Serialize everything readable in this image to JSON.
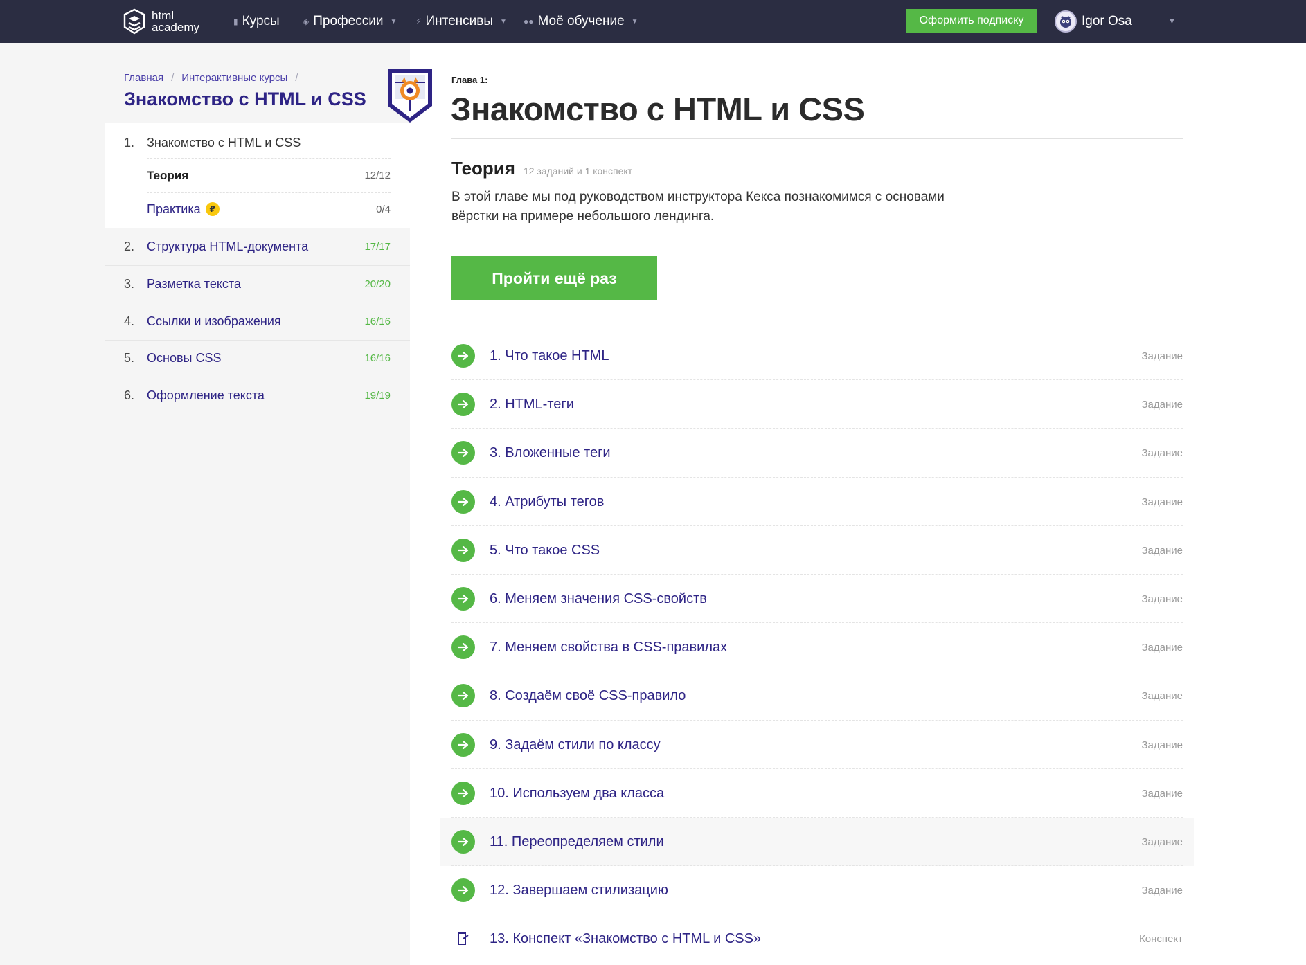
{
  "header": {
    "logo_line1": "html",
    "logo_line2": "academy",
    "nav": [
      {
        "label": "Курсы",
        "icon": "bar-chart-icon",
        "has_caret": false
      },
      {
        "label": "Профессии",
        "icon": "graduation-cap-icon",
        "has_caret": true
      },
      {
        "label": "Интенсивы",
        "icon": "lightning-icon",
        "has_caret": true
      },
      {
        "label": "Моё обучение",
        "icon": "users-icon",
        "has_caret": true
      }
    ],
    "subscribe_label": "Оформить подписку",
    "user_name": "Igor Osa"
  },
  "sidebar": {
    "breadcrumb": [
      "Главная",
      "Интерактивные курсы"
    ],
    "course_title": "Знакомство с HTML и CSS",
    "chapters": [
      {
        "num": "1.",
        "title": "Знакомство с HTML и CSS",
        "count": "",
        "sub": [
          {
            "title": "Теория",
            "count": "12/12"
          },
          {
            "title": "Практика",
            "count": "0/4"
          }
        ]
      },
      {
        "num": "2.",
        "title": "Структура HTML-документа",
        "count": "17/17"
      },
      {
        "num": "3.",
        "title": "Разметка текста",
        "count": "20/20"
      },
      {
        "num": "4.",
        "title": "Ссылки и изображения",
        "count": "16/16"
      },
      {
        "num": "5.",
        "title": "Основы CSS",
        "count": "16/16"
      },
      {
        "num": "6.",
        "title": "Оформление текста",
        "count": "19/19"
      }
    ],
    "coin_symbol": "₽"
  },
  "main": {
    "chapter_label": "Глава 1:",
    "title": "Знакомство с HTML и CSS",
    "theory_title": "Теория",
    "theory_sub": "12 заданий и 1 конспект",
    "description": "В этой главе мы под руководством инструктора Кекса познакомимся с основами вёрстки на примере небольшого лендинга.",
    "again_label": "Пройти ещё раз",
    "lessons": [
      {
        "title": "1. Что такое HTML",
        "type": "Задание"
      },
      {
        "title": "2. HTML-теги",
        "type": "Задание"
      },
      {
        "title": "3. Вложенные теги",
        "type": "Задание"
      },
      {
        "title": "4. Атрибуты тегов",
        "type": "Задание"
      },
      {
        "title": "5. Что такое CSS",
        "type": "Задание"
      },
      {
        "title": "6. Меняем значения CSS-свойств",
        "type": "Задание"
      },
      {
        "title": "7. Меняем свойства в CSS-правилах",
        "type": "Задание"
      },
      {
        "title": "8. Создаём своё CSS-правило",
        "type": "Задание"
      },
      {
        "title": "9. Задаём стили по классу",
        "type": "Задание"
      },
      {
        "title": "10. Используем два класса",
        "type": "Задание"
      },
      {
        "title": "11. Переопределяем стили",
        "type": "Задание"
      },
      {
        "title": "12. Завершаем стилизацию",
        "type": "Задание"
      },
      {
        "title": "13. Конспект «Знакомство с HTML и CSS»",
        "type": "Конспект"
      }
    ]
  },
  "colors": {
    "header_bg": "#2b2d42",
    "accent_green": "#55b846",
    "link_purple": "#2e2485",
    "sidebar_bg": "#f5f5f5"
  }
}
